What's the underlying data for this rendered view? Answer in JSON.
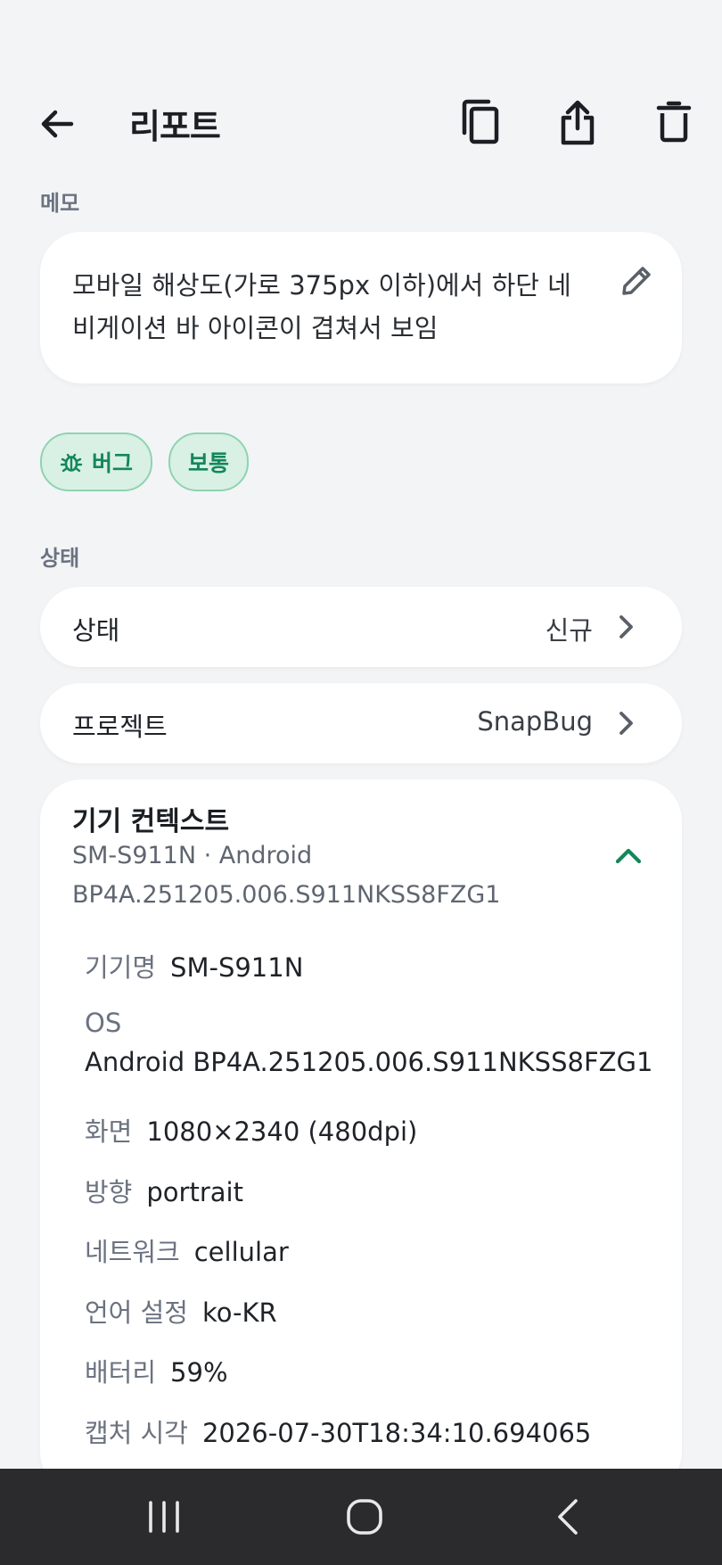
{
  "appbar": {
    "title": "리포트",
    "actions": [
      "copy-icon",
      "share-icon",
      "delete-icon"
    ]
  },
  "memo": {
    "section_label": "메모",
    "text": "모바일 해상도(가로 375px 이하)에서 하단 네비게이션 바 아이콘이 겹쳐서 보임"
  },
  "chips": [
    {
      "label": "버그",
      "icon": "bug-icon"
    },
    {
      "label": "보통"
    }
  ],
  "status": {
    "section_label": "상태",
    "rows": [
      {
        "label": "상태",
        "value": "신규"
      },
      {
        "label": "프로젝트",
        "value": "SnapBug"
      }
    ]
  },
  "device_context": {
    "title": "기기 컨텍스트",
    "summary_line1": "SM-S911N · Android",
    "summary_line2": "BP4A.251205.006.S911NKSS8FZG1",
    "fields": [
      {
        "key": "기기명",
        "value": "SM-S911N"
      },
      {
        "key": "OS",
        "value": "Android BP4A.251205.006.S911NKSS8FZG1"
      },
      {
        "key": "화면",
        "value": "1080×2340 (480dpi)"
      },
      {
        "key": "방향",
        "value": "portrait"
      },
      {
        "key": "네트워크",
        "value": "cellular"
      },
      {
        "key": "언어 설정",
        "value": "ko-KR"
      },
      {
        "key": "배터리",
        "value": "59%"
      },
      {
        "key": "캡처 시각",
        "value": "2026-07-30T18:34:10.694065"
      }
    ]
  },
  "colors": {
    "accent": "#14875a",
    "chip_bg": "#d8f1e4",
    "background": "#f3f4f6",
    "navbar": "#2b2b2d"
  }
}
